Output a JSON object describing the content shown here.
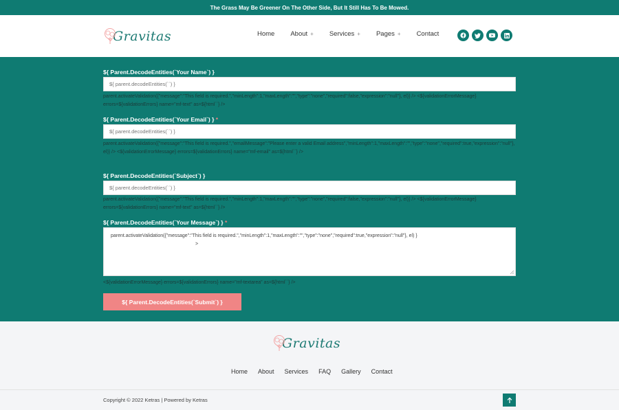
{
  "topbar": {
    "message": "The Grass May Be Greener On The Other Side, But It Still Has To Be Mowed."
  },
  "header": {
    "logo_text": "Gravitas",
    "nav": [
      {
        "label": "Home",
        "has_submenu": false
      },
      {
        "label": "About",
        "has_submenu": true
      },
      {
        "label": "Services",
        "has_submenu": true
      },
      {
        "label": "Pages",
        "has_submenu": true
      },
      {
        "label": "Contact",
        "has_submenu": false
      }
    ],
    "submenu_glyph": "+",
    "social": [
      "facebook-icon",
      "twitter-icon",
      "youtube-icon",
      "linkedin-icon"
    ]
  },
  "form": {
    "name_label": "${ Parent.DecodeEntities(`Your Name`) }",
    "name_placeholder": "${ parent.decodeEntities(``) }",
    "name_help": "parent.activateValidation({\"message\":\"This field is required.\",\"minLength\":1,\"maxLength\":\"\",\"type\":\"none\",\"required\":false,\"expression\":\"null\"}, el)} /> <${validationErrorMessage} errors=${validationErrors} name=\"mf-text\" as=${html``} />",
    "email_label": "${ Parent.DecodeEntities(`Your Email`) }",
    "email_required_mark": "*",
    "email_placeholder": "${ parent.decodeEntities(``) }",
    "email_help": "parent.activateValidation({\"message\":\"This field is required.\",\"emailMessage\":\"Please enter a valid Email address\",\"minLength\":1,\"maxLength\":\"\",\"type\":\"none\",\"required\":true,\"expression\":\"null\"}, el)} /> <${validationErrorMessage} errors=${validationErrors} name=\"mf-email\" as=${html``} />",
    "subject_label": "${ Parent.DecodeEntities(`Subject`) }",
    "subject_placeholder": "${ parent.decodeEntities(``) }",
    "subject_help": "parent.activateValidation({\"message\":\"This field is required.\",\"minLength\":1,\"maxLength\":\"\",\"type\":\"none\",\"required\":false,\"expression\":\"null\"}, el)} /> <${validationErrorMessage} errors=${validationErrors} name=\"mf-text\" as=${html``} />",
    "message_label": "${ Parent.DecodeEntities(`Your Message`) }",
    "message_required_mark": "*",
    "message_value_line1": "parent.activateValidation({\"message\":\"This field is required.\",\"minLength\":1,\"maxLength\":\"\",\"type\":\"none\",\"required\":true,\"expression\":\"null\"}, el) }",
    "message_value_line2": ">",
    "message_help": "<${validationErrorMessage} errors=${validationErrors} name=\"mf-textarea\" as=${html``} />",
    "submit_label": "${ Parent.DecodeEntities(`Submit`) }"
  },
  "footer": {
    "logo_text": "Gravitas",
    "nav": [
      "Home",
      "About",
      "Services",
      "FAQ",
      "Gallery",
      "Contact"
    ],
    "copyright": "Copyright © 2022 Ketras | Powered by Ketras"
  },
  "colors": {
    "brand": "#0f7b72",
    "accent": "#f08585",
    "background": "#f4f5f7"
  }
}
